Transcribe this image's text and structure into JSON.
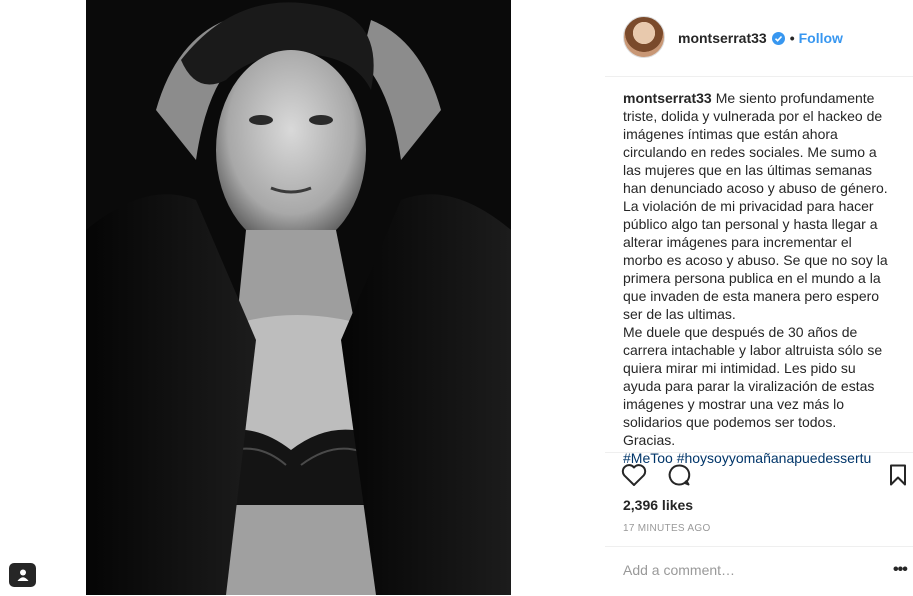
{
  "post": {
    "username": "montserrat33",
    "follow_label": "Follow",
    "separator": "•",
    "caption_user": "montserrat33",
    "caption_p1": "Me siento profundamente triste, dolida y vulnerada por el hackeo de imágenes íntimas que están ahora circulando en redes sociales. Me sumo a las mujeres que en las últimas semanas han denunciado acoso y abuso de género. La violación de mi privacidad para hacer público algo tan personal y hasta llegar a alterar imágenes para incrementar el morbo es acoso y abuso. Se que no soy la primera persona publica en el mundo a la que invaden de esta manera pero espero ser de las ultimas.",
    "caption_p2": "Me duele que después de 30 años de carrera intachable y labor altruista sólo se quiera mirar mi intimidad. Les pido su ayuda para parar la viralización de estas imágenes y mostrar una vez más lo solidarios que podemos ser todos. Gracias.",
    "hashtag_1": "#MeToo",
    "hashtag_2": "#hoysoyyomañanapuedessertu",
    "likes": "2,396 likes",
    "time": "17 MINUTES AGO",
    "comment_placeholder": "Add a comment…",
    "more_label": "•••"
  },
  "icons": {
    "verified": "verified-badge-icon",
    "like": "heart-icon",
    "comment": "comment-icon",
    "save": "bookmark-icon",
    "tag": "user-tag-icon"
  },
  "colors": {
    "link": "#3897f0",
    "hashtag": "#003569",
    "muted": "#999999",
    "text": "#262626"
  }
}
